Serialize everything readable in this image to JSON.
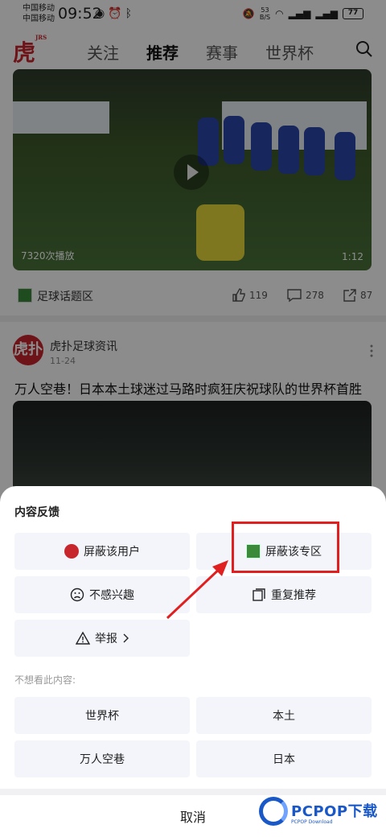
{
  "status_bar": {
    "carrier1": "中国移动",
    "carrier2": "中国移动",
    "time": "09:52",
    "net_speed": "53",
    "net_unit": "B/S",
    "battery": "77"
  },
  "nav": {
    "tabs": [
      {
        "label": "关注"
      },
      {
        "label": "推荐"
      },
      {
        "label": "赛事"
      },
      {
        "label": "世界杯"
      }
    ],
    "active_tab": "推荐"
  },
  "video_card": {
    "play_count": "7320次播放",
    "duration": "1:12",
    "topic": "足球话题区",
    "likes": "119",
    "comments": "278",
    "shares": "87"
  },
  "post": {
    "author": "虎扑足球资讯",
    "date": "11-24",
    "title": "万人空巷！日本本土球迷过马路时疯狂庆祝球队的世界杯首胜"
  },
  "sheet": {
    "title": "内容反馈",
    "options": [
      {
        "label": "屏蔽该用户"
      },
      {
        "label": "屏蔽该专区"
      },
      {
        "label": "不感兴趣"
      },
      {
        "label": "重复推荐"
      },
      {
        "label": "举报"
      }
    ],
    "subtitle": "不想看此内容:",
    "tags": [
      "世界杯",
      "本土",
      "万人空巷",
      "日本"
    ],
    "cancel": "取消"
  },
  "watermark": {
    "text": "PCPOP下载",
    "sub": "PCPOP Download"
  },
  "colors": {
    "brand_red": "#c8262d",
    "highlight_red": "#e02020",
    "option_bg": "#f3f5fa"
  }
}
